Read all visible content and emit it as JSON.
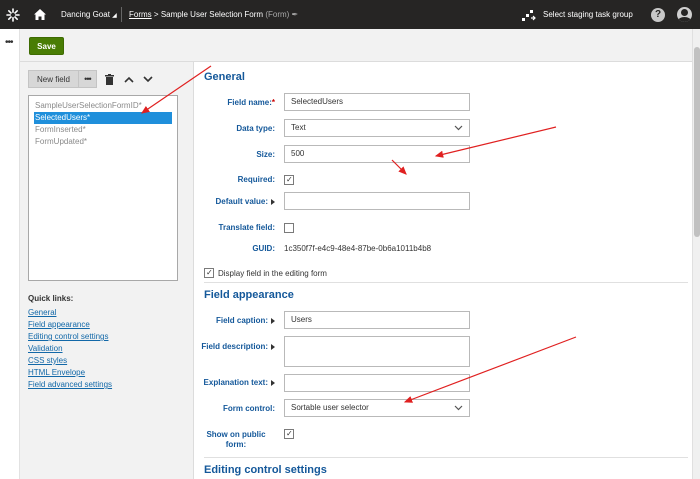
{
  "topbar": {
    "site_name": "Dancing Goat",
    "breadcrumb_parent": "Forms",
    "breadcrumb_sep": ">",
    "breadcrumb_current": "Sample User Selection Form",
    "breadcrumb_type": "(Form)",
    "staging_label": "Select staging task group",
    "help_label": "?"
  },
  "toolbar": {
    "save_label": "Save"
  },
  "left_panel": {
    "new_field_label": "New field",
    "more_label": "•••",
    "fields": [
      {
        "label": "SampleUserSelectionFormID*"
      },
      {
        "label": "SelectedUsers*"
      },
      {
        "label": "FormInserted*"
      },
      {
        "label": "FormUpdated*"
      }
    ],
    "quick_links_title": "Quick links:",
    "quick_links": [
      "General",
      "Field appearance",
      "Editing control settings",
      "Validation",
      "CSS styles",
      "HTML Envelope",
      "Field advanced settings"
    ]
  },
  "general": {
    "title": "General",
    "field_name_label": "Field name:",
    "required_star": "*",
    "field_name_value": "SelectedUsers",
    "data_type_label": "Data type:",
    "data_type_value": "Text",
    "size_label": "Size:",
    "size_value": "500",
    "required_label": "Required:",
    "default_value_label": "Default value:",
    "translate_label": "Translate field:",
    "guid_label": "GUID:",
    "guid_value": "1c350f7f-e4c9-48e4-87be-0b6a1011b4b8",
    "display_in_form_label": "Display field in the editing form"
  },
  "appearance": {
    "title": "Field appearance",
    "caption_label": "Field caption:",
    "caption_value": "Users",
    "description_label": "Field description:",
    "explanation_label": "Explanation text:",
    "form_control_label": "Form control:",
    "form_control_value": "Sortable user selector",
    "show_public_label_1": "Show on public",
    "show_public_label_2": "form:"
  },
  "editing_settings": {
    "title": "Editing control settings"
  },
  "colors": {
    "accent": "#14589a",
    "save": "#497d04",
    "selected": "#1f8fdb",
    "annotation": "#e02020",
    "topbar": "#262524"
  }
}
